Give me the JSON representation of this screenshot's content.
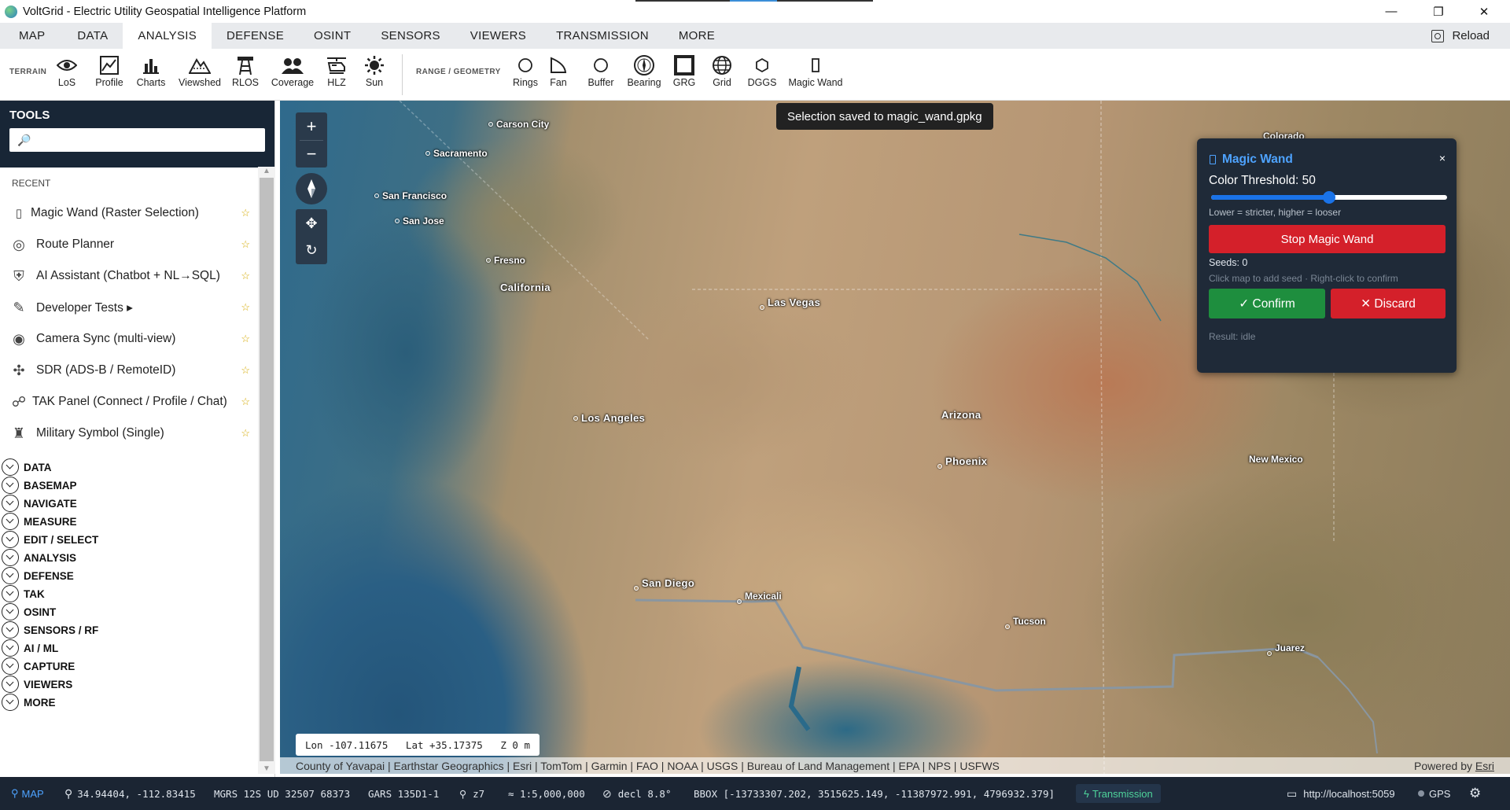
{
  "window": {
    "title": "VoltGrid - Electric Utility Geospatial Intelligence Platform",
    "minimize": "—",
    "restore": "❐",
    "close": "✕"
  },
  "menu": {
    "tabs": [
      "MAP",
      "DATA",
      "ANALYSIS",
      "DEFENSE",
      "OSINT",
      "SENSORS",
      "VIEWERS",
      "TRANSMISSION",
      "MORE"
    ],
    "active": "ANALYSIS",
    "reload": "Reload"
  },
  "toolbar": {
    "terrain_group": "TERRAIN",
    "range_group": "RANGE / GEOMETRY",
    "terrain_tools": [
      {
        "label": "LoS",
        "icon": "eye-icon"
      },
      {
        "label": "Profile",
        "icon": "profile-icon"
      },
      {
        "label": "Charts",
        "icon": "bar-chart-icon"
      },
      {
        "label": "Viewshed",
        "icon": "mountain-icon"
      },
      {
        "label": "RLOS",
        "icon": "radio-tower-icon"
      },
      {
        "label": "Coverage",
        "icon": "coverage-icon"
      },
      {
        "label": "HLZ",
        "icon": "helicopter-icon"
      },
      {
        "label": "Sun",
        "icon": "sun-icon"
      }
    ],
    "range_tools": [
      {
        "label": "Rings",
        "icon": "ring-icon"
      },
      {
        "label": "Fan",
        "icon": "fan-icon"
      },
      {
        "label": "Buffer",
        "icon": "buffer-icon"
      },
      {
        "label": "Bearing",
        "icon": "compass-icon"
      },
      {
        "label": "GRG",
        "icon": "grg-icon"
      },
      {
        "label": "Grid",
        "icon": "globe-grid-icon"
      },
      {
        "label": "DGGS",
        "icon": "hexagon-icon"
      },
      {
        "label": "Magic Wand",
        "icon": "magic-wand-icon"
      }
    ]
  },
  "sidebar": {
    "title": "TOOLS",
    "search_icon": "🔎",
    "recent_label": "RECENT",
    "recent": [
      {
        "label": "Magic Wand (Raster Selection)",
        "icon": "▯"
      },
      {
        "label": "Route Planner",
        "icon": "◎"
      },
      {
        "label": "AI Assistant (Chatbot + NL→SQL)",
        "icon": "⛨"
      },
      {
        "label": "Developer Tests ▸",
        "icon": "✎"
      },
      {
        "label": "Camera Sync (multi-view)",
        "icon": "◉"
      },
      {
        "label": "SDR (ADS-B / RemoteID)",
        "icon": "✣"
      },
      {
        "label": "TAK Panel (Connect / Profile / Chat)",
        "icon": "☍"
      },
      {
        "label": "Military Symbol (Single)",
        "icon": "♜"
      }
    ],
    "star": "☆",
    "categories": [
      "DATA",
      "BASEMAP",
      "NAVIGATE",
      "MEASURE",
      "EDIT / SELECT",
      "ANALYSIS",
      "DEFENSE",
      "TAK",
      "OSINT",
      "SENSORS / RF",
      "AI / ML",
      "CAPTURE",
      "VIEWERS",
      "MORE"
    ]
  },
  "map": {
    "zoom_in": "+",
    "zoom_out": "−",
    "toast": "Selection saved to magic_wand.gpkg",
    "places": [
      {
        "name": "Carson City",
        "dot": true
      },
      {
        "name": "Sacramento",
        "dot": true
      },
      {
        "name": "San Francisco",
        "dot": true
      },
      {
        "name": "San Jose",
        "dot": true
      },
      {
        "name": "Fresno",
        "dot": true
      },
      {
        "name": "California",
        "dot": false
      },
      {
        "name": "Las Vegas",
        "dot": true
      },
      {
        "name": "Los Angeles",
        "dot": true
      },
      {
        "name": "Arizona",
        "dot": false
      },
      {
        "name": "Phoenix",
        "dot": true
      },
      {
        "name": "San Diego",
        "dot": true
      },
      {
        "name": "Mexicali",
        "dot": true
      },
      {
        "name": "Tucson",
        "dot": true
      },
      {
        "name": "Juarez",
        "dot": true
      },
      {
        "name": "New Mexico",
        "dot": false
      },
      {
        "name": "Colorado",
        "dot": false
      }
    ],
    "coord_readout": "Lon -107.11675   Lat +35.17375   Z 0 m",
    "attribution": "County of Yavapai | Earthstar Geographics | Esri | TomTom | Garmin | FAO | NOAA | USGS | Bureau of Land Management | EPA | NPS | USFWS",
    "powered_by": "Powered by",
    "powered_link": "Esri"
  },
  "magic_wand": {
    "title": "Magic Wand",
    "close": "×",
    "threshold_label": "Color Threshold: 50",
    "threshold_value": 50,
    "threshold_max": 100,
    "hint": "Lower = stricter, higher = looser",
    "stop_button": "Stop Magic Wand",
    "seeds": "Seeds: 0",
    "instructions": "Click map to add seed · Right-click to confirm",
    "confirm_button": "✓ Confirm",
    "discard_button": "✕ Discard",
    "result": "Result: idle"
  },
  "statusbar": {
    "map_label": "MAP",
    "latlon": "34.94404, -112.83415",
    "mgrs": "MGRS 12S UD 32507 68373",
    "gars": "GARS 135D1-1",
    "zoom": "z7",
    "scale": "≈ 1:5,000,000",
    "decl": "decl 8.8°",
    "bbox": "BBOX [-13733307.202, 3515625.149, -11387972.991, 4796932.379]",
    "transmission": "Transmission",
    "server": "http://localhost:5059",
    "gps": "GPS"
  }
}
